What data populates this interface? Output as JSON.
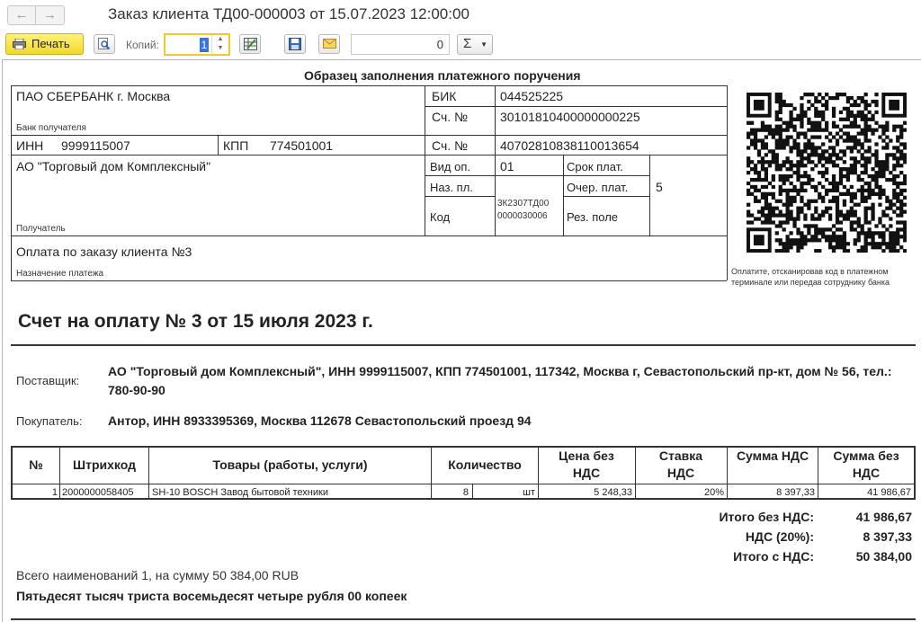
{
  "window": {
    "title": "Заказ клиента ТД00-000003 от 15.07.2023 12:00:00",
    "back_icon": "arrow-left-icon",
    "forward_icon": "arrow-right-icon"
  },
  "toolbar": {
    "print_label": "Печать",
    "copies_label": "Копий:",
    "copies_value": "1",
    "sum_value": "0",
    "sigma_label": "Σ"
  },
  "payment_sample": {
    "title": "Образец заполнения платежного поручения",
    "bank_name": "ПАО СБЕРБАНК г. Москва",
    "bank_label": "Банк получателя",
    "bik_label": "БИК",
    "bik_value": "044525225",
    "corr_account_label": "Сч. №",
    "corr_account_value": "30101810400000000225",
    "inn_label": "ИНН",
    "inn_value": "9999115007",
    "kpp_label": "КПП",
    "kpp_value": "774501001",
    "account_label": "Сч. №",
    "account_value": "40702810838110013654",
    "recipient_name": "АО \"Торговый дом Комплексный\"",
    "recipient_label": "Получатель",
    "op_type_label": "Вид оп.",
    "op_type_value": "01",
    "purpose_code_label": "Наз. пл.",
    "code_label": "Код",
    "code_value_line1": "3К2307ТД00",
    "code_value_line2": "0000030006",
    "pay_term_label": "Срок плат.",
    "pay_order_label": "Очер. плат.",
    "pay_order_value": "5",
    "reserve_label": "Рез. поле",
    "purpose_text": "Оплата по заказу клиента №3",
    "purpose_label": "Назначение платежа",
    "qr_caption_line1": "Оплатите, отсканировав код в платежном",
    "qr_caption_line2": "терминале или передав сотруднику банка"
  },
  "invoice": {
    "title": "Счет на оплату № 3 от 15 июля 2023 г.",
    "supplier_label": "Поставщик:",
    "supplier_text": "АО \"Торговый дом Комплексный\", ИНН 9999115007, КПП 774501001, 117342, Москва г, Севастопольский пр-кт, дом № 56, тел.: 780-90-90",
    "buyer_label": "Покупатель:",
    "buyer_text": "Антор, ИНН 8933395369, Москва 112678 Севастопольский проезд 94"
  },
  "table": {
    "headers": [
      "№",
      "Штрихкод",
      "Товары (работы, услуги)",
      "Количество",
      "Цена без НДС",
      "Ставка НДС",
      "Сумма НДС",
      "Сумма без НДС"
    ],
    "rows": [
      {
        "num": "1",
        "barcode": "2000000058405",
        "item": "SH-10 BOSCH Завод бытовой техники",
        "qty": "8",
        "unit": "шт",
        "price": "5 248,33",
        "rate": "20%",
        "vat_sum": "8 397,33",
        "sum": "41 986,67"
      }
    ]
  },
  "totals": {
    "no_vat_label": "Итого без НДС:",
    "no_vat_value": "41 986,67",
    "vat_label": "НДС (20%):",
    "vat_value": "8 397,33",
    "with_vat_label": "Итого с НДС:",
    "with_vat_value": "50 384,00"
  },
  "summary": {
    "items_line": "Всего наименований 1, на сумму 50 384,00 RUB",
    "amount_words": "Пятьдесят тысяч триста восемьдесят четыре рубля 00 копеек"
  }
}
